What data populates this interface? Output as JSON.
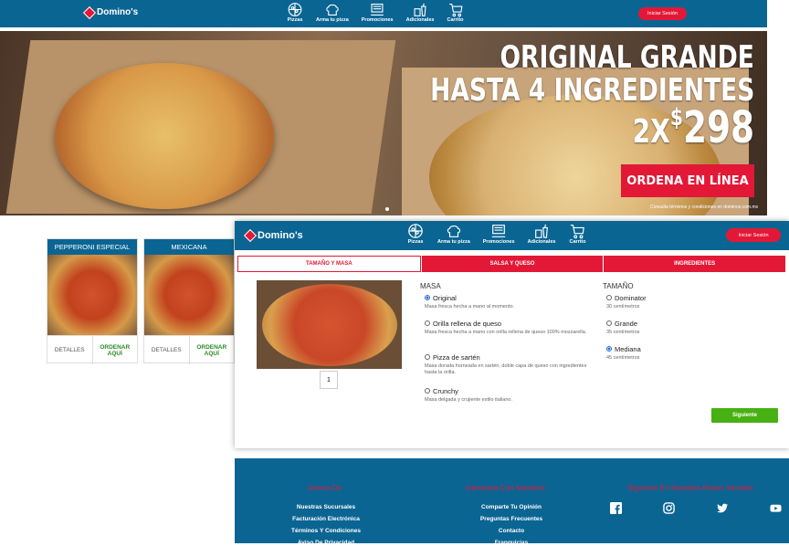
{
  "header": {
    "brand": "Domino's",
    "nav": [
      {
        "label": "Pizzas",
        "icon": "pizza-icon"
      },
      {
        "label": "Arma tu pizza",
        "icon": "chef-hat-icon"
      },
      {
        "label": "Promociones",
        "icon": "promotions-icon"
      },
      {
        "label": "Adicionales",
        "icon": "drink-icon"
      },
      {
        "label": "Carrito",
        "icon": "cart-icon"
      }
    ],
    "login": "Iniciar Sesión"
  },
  "hero": {
    "line1": "ORIGINAL GRANDE",
    "line2": "HASTA 4 INGREDIENTES",
    "price_prefix": "2X",
    "price_currency": "$",
    "price_value": "298",
    "cta": "ORDENA EN LÍNEA",
    "legal": "Consulta términos y condiciones en dominos.com.mx"
  },
  "cards": [
    {
      "title": "PEPPERONI ESPECIAL",
      "details": "DETALLES",
      "order": "ORDENAR AQUÍ"
    },
    {
      "title": "MEXICANA",
      "details": "DETALLES",
      "order": "ORDENAR AQUÍ"
    }
  ],
  "modal": {
    "brand": "Domino's",
    "nav": [
      {
        "label": "Pizzas"
      },
      {
        "label": "Arma tu pizza"
      },
      {
        "label": "Promociones"
      },
      {
        "label": "Adicionales"
      },
      {
        "label": "Carrito"
      }
    ],
    "login": "Iniciar Sesión",
    "tabs": [
      "TAMAÑO Y MASA",
      "SALSA Y QUESO",
      "INGREDIENTES"
    ],
    "quantity": "1",
    "masa_title": "MASA",
    "masa_options": [
      {
        "label": "Original",
        "desc": "Masa fresca hecha a mano al momento.",
        "selected": true
      },
      {
        "label": "Orilla rellena de queso",
        "desc": "Masa fresca hecha a mano con orilla rellena de queso 100% mozzarella.",
        "selected": false
      },
      {
        "label": "Pizza de sartén",
        "desc": "Masa dorada horneada en sartén, doble capa de queso con ingredientes hasta la orilla.",
        "selected": false
      },
      {
        "label": "Crunchy",
        "desc": "Masa delgada y crujiente estilo italiano.",
        "selected": false
      }
    ],
    "size_title": "TAMAÑO",
    "size_options": [
      {
        "label": "Dominator",
        "desc": "30 centímetros",
        "selected": false
      },
      {
        "label": "Grande",
        "desc": "35 centímetros",
        "selected": false
      },
      {
        "label": "Mediana",
        "desc": "45 centímetros",
        "selected": true
      }
    ],
    "next": "Siguiente"
  },
  "footer": {
    "col1_title": "Acerca De",
    "col1_links": [
      "Nuestras Sucursales",
      "Facturación Electrónica",
      "Términos Y Condiciones",
      "Aviso De Privacidad"
    ],
    "col2_title": "Interactúa Con Nosotros",
    "col2_links": [
      "Comparte Tu Opinión",
      "Preguntas Frecuentes",
      "Contacto",
      "Franquicias"
    ],
    "col3_title": "Síguenos En Nuestras Redes Sociales",
    "social": [
      "facebook-icon",
      "instagram-icon",
      "twitter-icon",
      "youtube-icon"
    ]
  }
}
